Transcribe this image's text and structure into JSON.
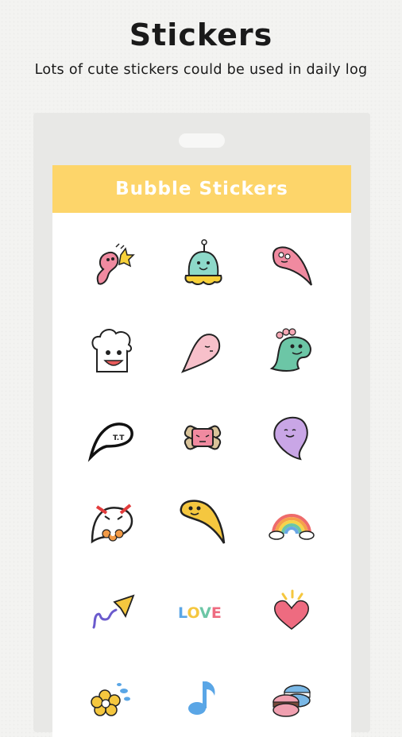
{
  "header": {
    "title": "Stickers",
    "subtitle": "Lots of cute stickers could be used in daily log"
  },
  "screen": {
    "banner_title": "Bubble Stickers",
    "banner_color": "#fdd56a"
  },
  "stickers": [
    {
      "name": "pink-creature-sticker"
    },
    {
      "name": "green-alien-sticker"
    },
    {
      "name": "pink-blob-sticker"
    },
    {
      "name": "chef-hat-sticker"
    },
    {
      "name": "pink-speech-blob-sticker"
    },
    {
      "name": "green-dino-sticker"
    },
    {
      "name": "black-speech-bubble-sticker"
    },
    {
      "name": "bandaged-face-sticker"
    },
    {
      "name": "purple-blob-sticker"
    },
    {
      "name": "angry-bubble-sticker"
    },
    {
      "name": "yellow-blob-sticker"
    },
    {
      "name": "rainbow-sticker"
    },
    {
      "name": "paper-plane-sticker"
    },
    {
      "name": "love-text-sticker",
      "text": "LOVE"
    },
    {
      "name": "heart-sticker"
    },
    {
      "name": "flower-sticker"
    },
    {
      "name": "music-note-sticker"
    },
    {
      "name": "macaron-sticker"
    }
  ]
}
